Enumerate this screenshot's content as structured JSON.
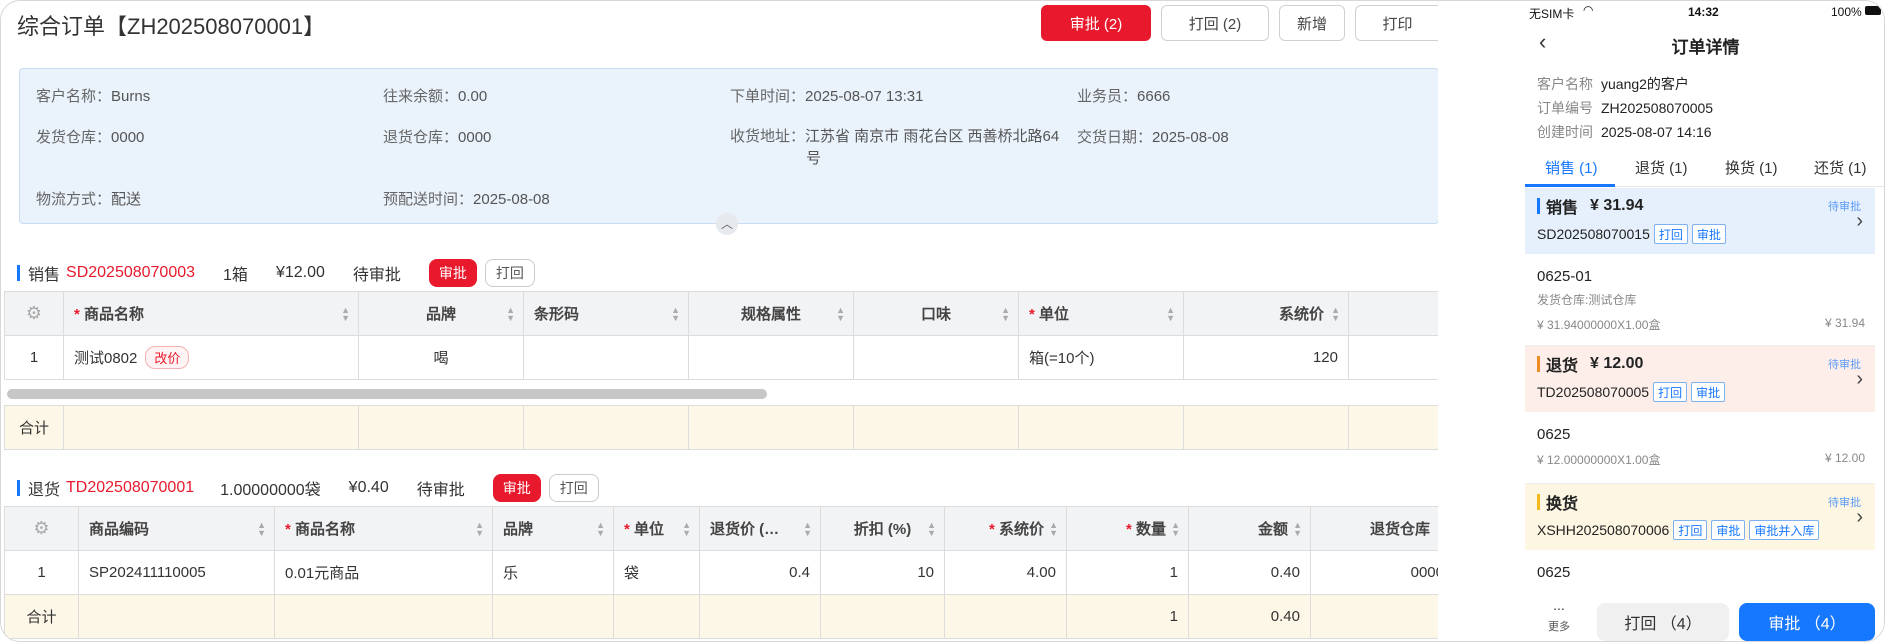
{
  "header": {
    "title": "综合订单【ZH202508070001】",
    "buttons": {
      "approve": "审批 (2)",
      "reject": "打回 (2)",
      "add": "新增",
      "print": "打印"
    }
  },
  "info": {
    "customer_label": "客户名称：",
    "customer": "Burns",
    "balance_label": "往来余额：",
    "balance": "0.00",
    "order_time_label": "下单时间：",
    "order_time": "2025-08-07 13:31",
    "salesman_label": "业务员：",
    "salesman": "6666",
    "ship_wh_label": "发货仓库：",
    "ship_wh": "0000",
    "return_wh_label": "退货仓库：",
    "return_wh": "0000",
    "address_label": "收货地址：",
    "address_line1": "江苏省 南京市 雨花台区 西善桥北路64",
    "address_line2": "号",
    "deal_date_label": "交货日期：",
    "deal_date": "2025-08-08",
    "logistics_label": "物流方式：",
    "logistics": "配送",
    "predelivery_label": "预配送时间：",
    "predelivery": "2025-08-08"
  },
  "sales": {
    "title": "销售",
    "code": "SD202508070003",
    "qty": "1箱",
    "amount": "¥12.00",
    "status": "待审批",
    "approve": "审批",
    "reject": "打回",
    "headers": [
      "商品名称",
      "品牌",
      "条形码",
      "规格属性",
      "口味",
      "单位",
      "系统价"
    ],
    "rows": [
      {
        "idx": "1",
        "name": "测试0802",
        "chip": "改价",
        "brand": "喝",
        "barcode": "",
        "spec": "",
        "flavor": "",
        "unit": "箱(=10个)",
        "price": "120"
      }
    ],
    "sum_label": "合计"
  },
  "returns": {
    "title": "退货",
    "code": "TD202508070001",
    "qty": "1.00000000袋",
    "amount": "¥0.40",
    "status": "待审批",
    "approve": "审批",
    "reject": "打回",
    "headers": [
      "商品编码",
      "商品名称",
      "品牌",
      "单位",
      "退货价 (…",
      "折扣 (%)",
      "系统价",
      "数量",
      "金额",
      "退货仓库"
    ],
    "rows": [
      {
        "idx": "1",
        "code": "SP202411110005",
        "name": "0.01元商品",
        "brand": "乐",
        "unit": "袋",
        "rprice": "0.4",
        "discount": "10",
        "sprice": "4.00",
        "qty": "1",
        "amount": "0.40",
        "wh": "0000"
      }
    ],
    "sum_label": "合计",
    "sum_qty": "1",
    "sum_amount": "0.40"
  },
  "mobile": {
    "status": {
      "carrier": "无SIM卡",
      "time": "14:32",
      "battery": "100%"
    },
    "title": "订单详情",
    "customer_label": "客户名称",
    "customer": "yuang2的客户",
    "order_no_label": "订单编号",
    "order_no": "ZH202508070005",
    "created_label": "创建时间",
    "created": "2025-08-07 14:16",
    "tabs": [
      "销售 (1)",
      "退货 (1)",
      "换货 (1)",
      "还货 (1)"
    ],
    "sale_card": {
      "title": "销售",
      "amount": "¥ 31.94",
      "status": "待审批",
      "code": "SD202508070015",
      "t1": "打回",
      "t2": "审批",
      "item_name": "0625-01",
      "item_wh": "发货仓库:测试仓库",
      "item_calc": "¥ 31.94000000X1.00盒",
      "item_total": "¥ 31.94"
    },
    "return_card": {
      "title": "退货",
      "amount": "¥ 12.00",
      "status": "待审批",
      "code": "TD202508070005",
      "t1": "打回",
      "t2": "审批",
      "item_name": "0625",
      "item_calc": "¥ 12.00000000X1.00盒",
      "item_total": "¥ 12.00"
    },
    "exchange_card": {
      "title": "换货",
      "status": "待审批",
      "code": "XSHH202508070006",
      "t1": "打回",
      "t2": "审批",
      "t3": "审批并入库",
      "item_name": "0625"
    },
    "more_dots": "...",
    "more": "更多",
    "reject": "打回 （4）",
    "approve": "审批 （4）"
  },
  "colors": {
    "red": "#e8192c",
    "blue": "#1677ff",
    "info_bg": "#eaf2fc",
    "sum_bg": "#fdf7e7"
  }
}
